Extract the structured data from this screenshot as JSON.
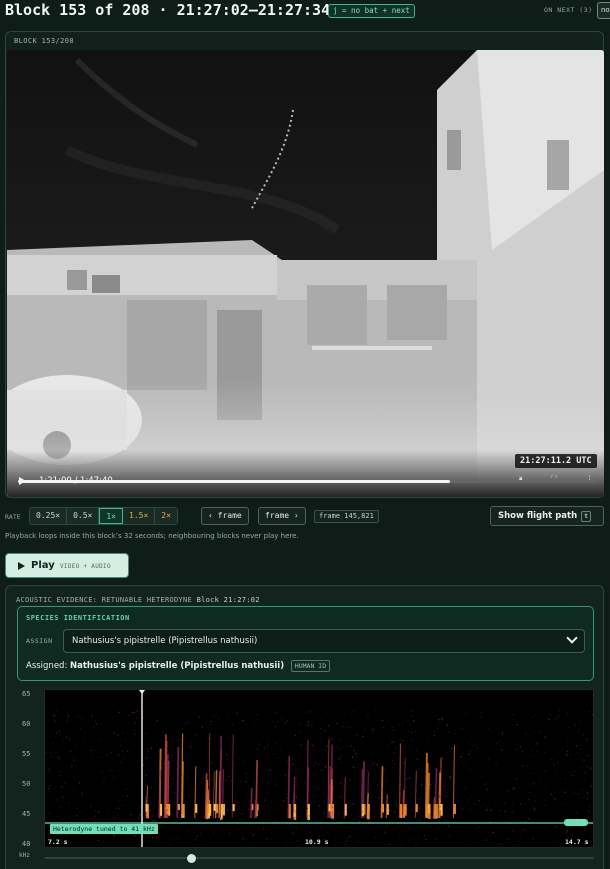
{
  "header": {
    "title": "Block 153 of 208 · 21:27:02–21:27:34 UTC",
    "hint": "j = no bat + next",
    "on_next": "ON NEXT (3)",
    "next_chip": "no"
  },
  "video": {
    "panel_label": "BLOCK 153/208",
    "timestamp": "21:27:11.2 UTC",
    "time_display": "1:21:00 / 1:47:40",
    "progress": 0.749,
    "icons": [
      "play-icon",
      "volume-icon",
      "fullscreen-icon",
      "more-icon"
    ]
  },
  "rate": {
    "label": "RATE",
    "options": [
      "0.25×",
      "0.5×",
      "1×",
      "1.5×",
      "2×"
    ],
    "selected": "1×",
    "prev_frame": "‹ frame",
    "next_frame": "frame ›",
    "frame_number": "frame 145,821",
    "flight_path": "Show flight path",
    "flight_key": "t"
  },
  "note": "Playback loops inside this block’s 32 seconds; neighbouring blocks never play here.",
  "play": {
    "label": "Play",
    "sub": "VIDEO + AUDIO"
  },
  "acoustic": {
    "heading": "ACOUSTIC EVIDENCE: RETUNABLE HETERODYNE",
    "heading_suffix": "Block 21:27:02",
    "species": {
      "heading": "SPECIES IDENTIFICATION",
      "assign_label": "ASSIGN",
      "selected": "Nathusius's pipistrelle (Pipistrellus nathusii)",
      "assigned_prefix": "Assigned:",
      "assigned_value": "Nathusius's pipistrelle (Pipistrellus nathusii)",
      "assigned_badge": "HUMAN ID"
    },
    "spectrogram": {
      "y_ticks": [
        "65",
        "60",
        "55",
        "50",
        "45",
        "40"
      ],
      "y_unit": "kHz",
      "heterodyne_label": "Heterodyne tuned to 41 kHz",
      "x_ticks": [
        "7.2 s",
        "10.9 s",
        "14.7 s"
      ]
    }
  }
}
